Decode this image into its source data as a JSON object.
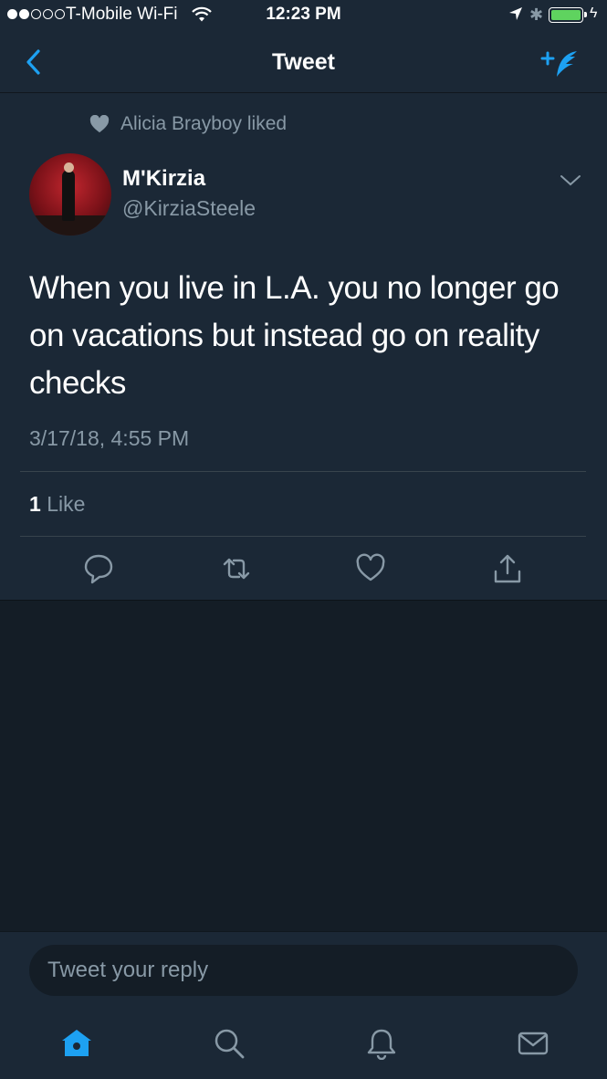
{
  "status_bar": {
    "carrier": "T-Mobile Wi-Fi",
    "time": "12:23 PM",
    "signal_bars": 2,
    "battery_color": "#5fd35f"
  },
  "nav": {
    "title": "Tweet",
    "back_icon": "chevron-left-icon",
    "compose_icon": "compose-tweet-icon"
  },
  "tweet": {
    "social_context": "Alicia Brayboy liked",
    "author_name": "M'Kirzia",
    "author_handle": "@KirziaSteele",
    "text": "When you live in L.A. you no longer go on vacations but instead go on reality checks",
    "timestamp": "3/17/18, 4:55 PM",
    "like_count": "1",
    "like_label": "Like",
    "actions": [
      "reply-icon",
      "retweet-icon",
      "like-icon",
      "share-icon"
    ]
  },
  "reply": {
    "placeholder": "Tweet your reply"
  },
  "tab_bar": {
    "tabs": [
      "home-icon",
      "search-icon",
      "notifications-icon",
      "messages-icon"
    ],
    "active": "home-icon"
  },
  "colors": {
    "accent": "#1da1f2",
    "background": "#1b2836",
    "muted_text": "#8899a6"
  }
}
